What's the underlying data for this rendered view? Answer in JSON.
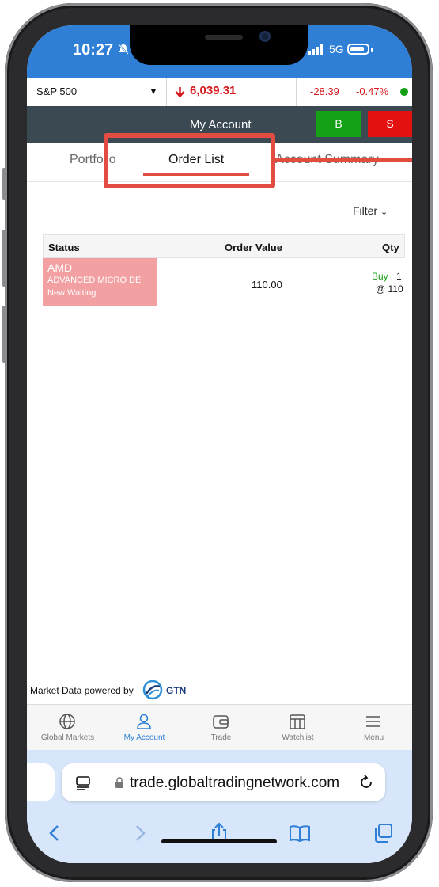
{
  "status_bar": {
    "time": "10:27",
    "network": "5G"
  },
  "ticker": {
    "index_name": "S&P 500",
    "price": "6,039.31",
    "change": "-28.39",
    "change_pct": "-0.47%"
  },
  "header": {
    "title": "My Account",
    "buy_label": "B",
    "sell_label": "S"
  },
  "tabs": [
    {
      "label": "Portfolio"
    },
    {
      "label": "Order List"
    },
    {
      "label": "Account Summary"
    }
  ],
  "filter_label": "Filter",
  "orders_table": {
    "columns": [
      "Status",
      "Order Value",
      "Qty"
    ],
    "rows": [
      {
        "symbol": "AMD",
        "company": "ADVANCED MICRO DE",
        "status": "New Waiting",
        "order_value": "110.00",
        "side": "Buy",
        "qty": "1",
        "price": "@ 110"
      }
    ]
  },
  "powered_by": {
    "text": "Market Data powered by",
    "brand": "GTN"
  },
  "bottom_nav": [
    {
      "label": "Global Markets",
      "icon": "globe-icon"
    },
    {
      "label": "My Account",
      "icon": "user-icon"
    },
    {
      "label": "Trade",
      "icon": "wallet-icon"
    },
    {
      "label": "Watchlist",
      "icon": "watchlist-icon"
    },
    {
      "label": "Menu",
      "icon": "menu-icon"
    }
  ],
  "browser": {
    "url": "trade.globaltradingnetwork.com"
  },
  "colors": {
    "accent": "#2f7fd6",
    "header_bg": "#3b4953",
    "negative": "#d6191d",
    "buy": "#15a115",
    "sell": "#e41111",
    "highlight": "#e34d41",
    "status_cell_bg": "#f3a0a2"
  }
}
